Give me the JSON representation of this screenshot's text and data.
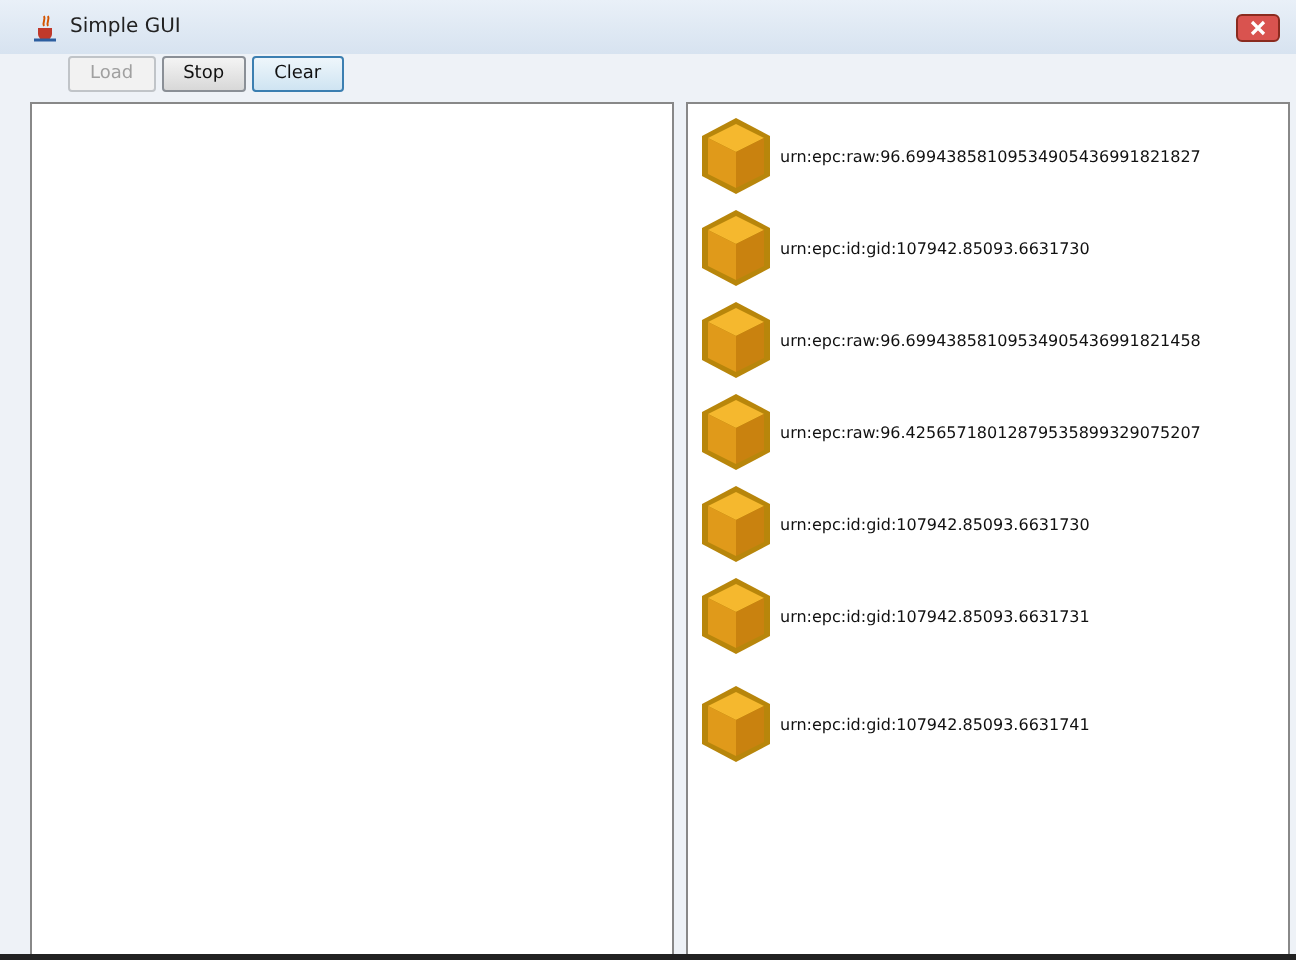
{
  "window": {
    "title": "Simple GUI"
  },
  "buttons": [
    {
      "label": "Load",
      "disabled": true,
      "focused": false
    },
    {
      "label": "Stop",
      "disabled": false,
      "focused": false
    },
    {
      "label": "Clear",
      "disabled": false,
      "focused": true
    }
  ],
  "tags": [
    {
      "label": "urn:epc:raw:96.69943858109534905436991821827"
    },
    {
      "label": "urn:epc:id:gid:107942.85093.6631730"
    },
    {
      "label": "urn:epc:raw:96.69943858109534905436991821458"
    },
    {
      "label": "urn:epc:raw:96.42565718012879535899329075207"
    },
    {
      "label": "urn:epc:id:gid:107942.85093.6631730"
    },
    {
      "label": "urn:epc:id:gid:107942.85093.6631731"
    },
    {
      "label": "urn:epc:id:gid:107942.85093.6631741"
    }
  ]
}
